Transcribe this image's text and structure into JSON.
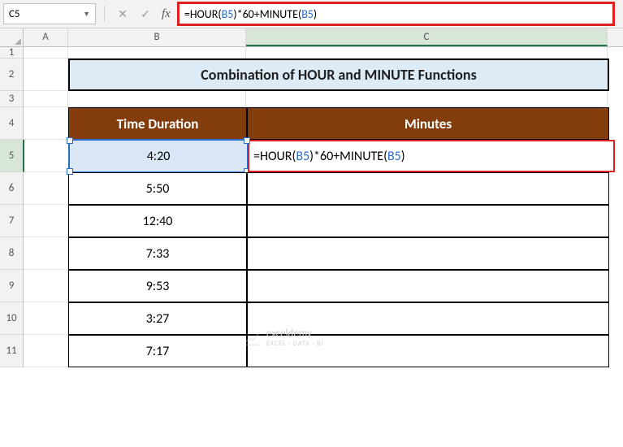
{
  "nameBox": {
    "value": "C5"
  },
  "formulaBar": {
    "prefix": "=",
    "fn1": "HOUR",
    "open1": "(",
    "ref1": "B5",
    "close1": ")",
    "op": "*60+",
    "fn2": "MINUTE",
    "open2": "(",
    "ref2": "B5",
    "close2": ")"
  },
  "columns": {
    "A": "A",
    "B": "B",
    "C": "C"
  },
  "rows": [
    "1",
    "2",
    "3",
    "4",
    "5",
    "6",
    "7",
    "8",
    "9",
    "10",
    "11"
  ],
  "title": "Combination of HOUR and MINUTE Functions",
  "headers": {
    "time": "Time Duration",
    "minutes": "Minutes"
  },
  "tableData": [
    {
      "time": "4:20"
    },
    {
      "time": "5:50"
    },
    {
      "time": "12:40"
    },
    {
      "time": "7:33"
    },
    {
      "time": "9:53"
    },
    {
      "time": "3:27"
    },
    {
      "time": "7:17"
    }
  ],
  "cellFormula": {
    "prefix": "=",
    "fn1": "HOUR",
    "open1": "(",
    "ref1": "B5",
    "close1": ")",
    "op": "*60+",
    "fn2": "MINUTE",
    "open2": "(",
    "ref2": "B5",
    "close2": ")"
  },
  "watermark": {
    "brand": "exceldemy",
    "tagline": "EXCEL · DATA · BI"
  }
}
